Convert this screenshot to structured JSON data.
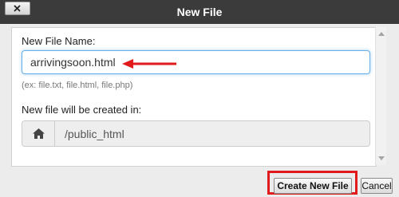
{
  "dialog": {
    "title": "New File",
    "close_glyph": "✕"
  },
  "form": {
    "name_label": "New File Name:",
    "name_value": "arrivingsoon.html",
    "name_hint": "(ex: file.txt, file.html, file.php)",
    "dir_label": "New file will be created in:",
    "dir_value": "/public_html",
    "dir_icon": "home-icon"
  },
  "buttons": {
    "create_label": "Create New File",
    "cancel_label": "Cancel"
  },
  "annotations": {
    "color": "#e11b1b"
  }
}
